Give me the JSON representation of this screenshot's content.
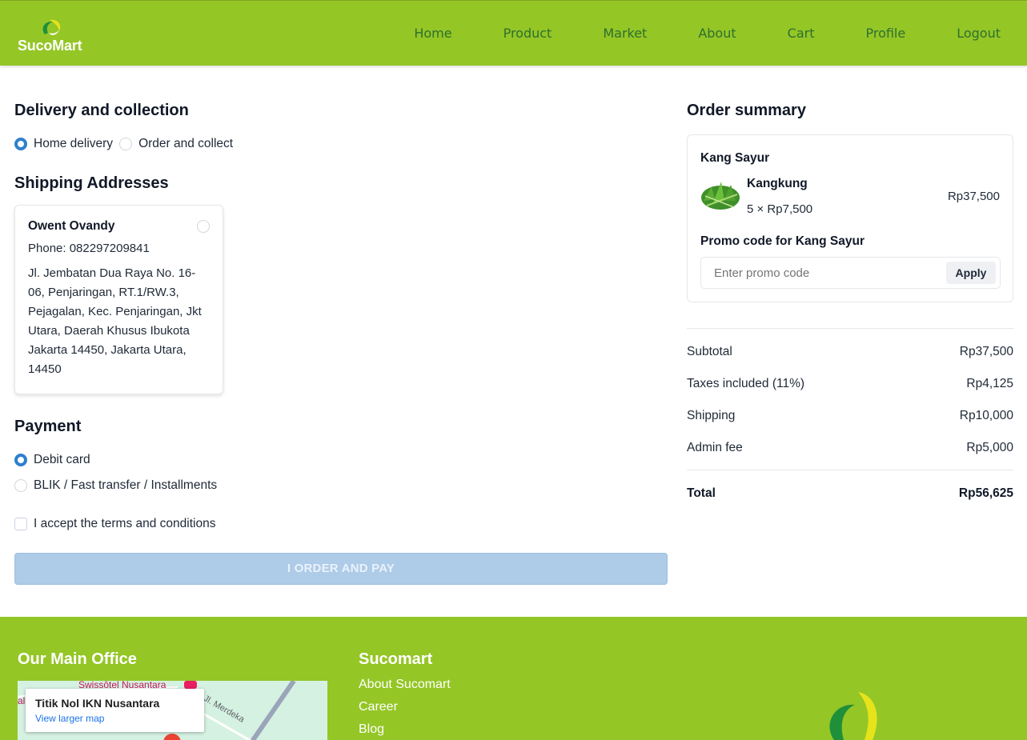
{
  "header": {
    "brand": "SucoMart",
    "nav": [
      "Home",
      "Product",
      "Market",
      "About",
      "Cart",
      "Profile",
      "Logout"
    ]
  },
  "delivery": {
    "title": "Delivery and collection",
    "options": [
      {
        "label": "Home delivery",
        "selected": true
      },
      {
        "label": "Order and collect",
        "selected": false
      }
    ]
  },
  "shipping": {
    "title": "Shipping Addresses",
    "address": {
      "name": "Owent Ovandy",
      "phone": "Phone: 082297209841",
      "text": "Jl. Jembatan Dua Raya No. 16-06, Penjaringan, RT.1/RW.3, Pejagalan, Kec. Penjaringan, Jkt Utara, Daerah Khusus Ibukota Jakarta 14450, Jakarta Utara, 14450"
    }
  },
  "payment": {
    "title": "Payment",
    "options": [
      {
        "label": "Debit card",
        "selected": true
      },
      {
        "label": "BLIK / Fast transfer / Installments",
        "selected": false
      }
    ],
    "terms": "I accept the terms and conditions",
    "order_button": "I ORDER AND PAY"
  },
  "summary": {
    "title": "Order summary",
    "store": "Kang Sayur",
    "item": {
      "name": "Kangkung",
      "qty": "5 × Rp7,500",
      "price": "Rp37,500"
    },
    "promo_label": "Promo code for Kang Sayur",
    "promo_placeholder": "Enter promo code",
    "promo_button": "Apply",
    "rows": [
      {
        "label": "Subtotal",
        "value": "Rp37,500"
      },
      {
        "label": "Taxes included (11%)",
        "value": "Rp4,125"
      },
      {
        "label": "Shipping",
        "value": "Rp10,000"
      },
      {
        "label": "Admin fee",
        "value": "Rp5,000"
      }
    ],
    "total": {
      "label": "Total",
      "value": "Rp56,625"
    }
  },
  "footer": {
    "office_title": "Our Main Office",
    "map": {
      "place": "Titik Nol IKN Nusantara",
      "link": "View larger map",
      "poi": "Swissôtel Nusantara",
      "road": "Jl. Merdeka",
      "edge_text": "al"
    },
    "sucomart_title": "Sucomart",
    "links": [
      "About Sucomart",
      "Career",
      "Blog"
    ]
  },
  "colors": {
    "brand_green": "#94c626",
    "nav_text": "#2f6f2f",
    "accent_blue": "#2f80cc",
    "button_disabled": "#aecbe8"
  }
}
